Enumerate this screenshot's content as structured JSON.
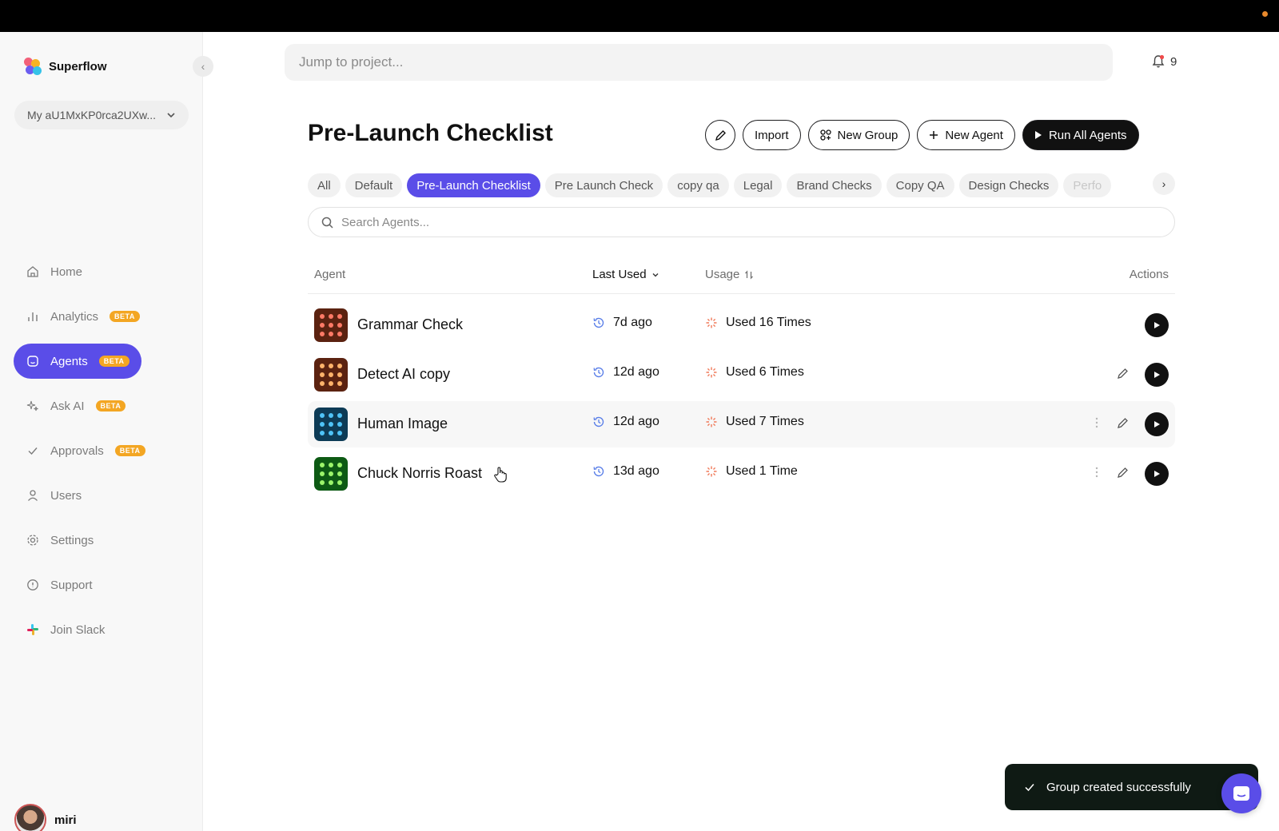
{
  "app": {
    "name": "Superflow",
    "workspace": "My aU1MxKP0rca2UXw..."
  },
  "nav": [
    {
      "label": "Home",
      "icon": "home-icon",
      "beta": "",
      "active": false
    },
    {
      "label": "Analytics",
      "icon": "bar-chart-icon",
      "beta": "BETA",
      "active": false
    },
    {
      "label": "Agents",
      "icon": "agent-icon",
      "beta": "BETA",
      "active": true
    },
    {
      "label": "Ask AI",
      "icon": "sparkle-icon",
      "beta": "BETA",
      "active": false
    },
    {
      "label": "Approvals",
      "icon": "check-icon",
      "beta": "BETA",
      "active": false
    },
    {
      "label": "Users",
      "icon": "user-icon",
      "beta": "",
      "active": false
    },
    {
      "label": "Settings",
      "icon": "gear-icon",
      "beta": "",
      "active": false
    },
    {
      "label": "Support",
      "icon": "info-icon",
      "beta": "",
      "active": false
    },
    {
      "label": "Join Slack",
      "icon": "slack-icon",
      "beta": "",
      "active": false
    }
  ],
  "user": {
    "name": "miri"
  },
  "header": {
    "jump_placeholder": "Jump to project...",
    "notification_count": "9"
  },
  "page": {
    "title": "Pre-Launch Checklist",
    "buttons": {
      "import": "Import",
      "new_group": "New Group",
      "new_agent": "New Agent",
      "run_all": "Run All Agents"
    }
  },
  "groups": [
    "All",
    "Default",
    "Pre-Launch Checklist",
    "Pre Launch Check",
    "copy qa",
    "Legal",
    "Brand Checks",
    "Copy QA",
    "Design Checks",
    "Perfo"
  ],
  "active_group": "Pre-Launch Checklist",
  "search": {
    "placeholder": "Search Agents..."
  },
  "table": {
    "headers": {
      "agent": "Agent",
      "last_used": "Last Used",
      "usage": "Usage",
      "actions": "Actions"
    },
    "rows": [
      {
        "name": "Grammar Check",
        "last_used": "7d ago",
        "usage": "Used 16 Times",
        "icon_bg": "#5b2210",
        "dot_color": "#ff7a66"
      },
      {
        "name": "Detect AI copy",
        "last_used": "12d ago",
        "usage": "Used 6 Times",
        "icon_bg": "#5b2210",
        "dot_color": "#ffb36b"
      },
      {
        "name": "Human Image",
        "last_used": "12d ago",
        "usage": "Used 7 Times",
        "icon_bg": "#0d3b56",
        "dot_color": "#4fc3f7"
      },
      {
        "name": "Chuck Norris Roast",
        "last_used": "13d ago",
        "usage": "Used 1 Time",
        "icon_bg": "#0d5a14",
        "dot_color": "#9cf56b"
      }
    ]
  },
  "toast": {
    "message": "Group created successfully"
  },
  "colors": {
    "accent": "#5a4de8",
    "beta": "#f3a623",
    "clock": "#5a7fe8",
    "usage": "#f07a5a"
  }
}
